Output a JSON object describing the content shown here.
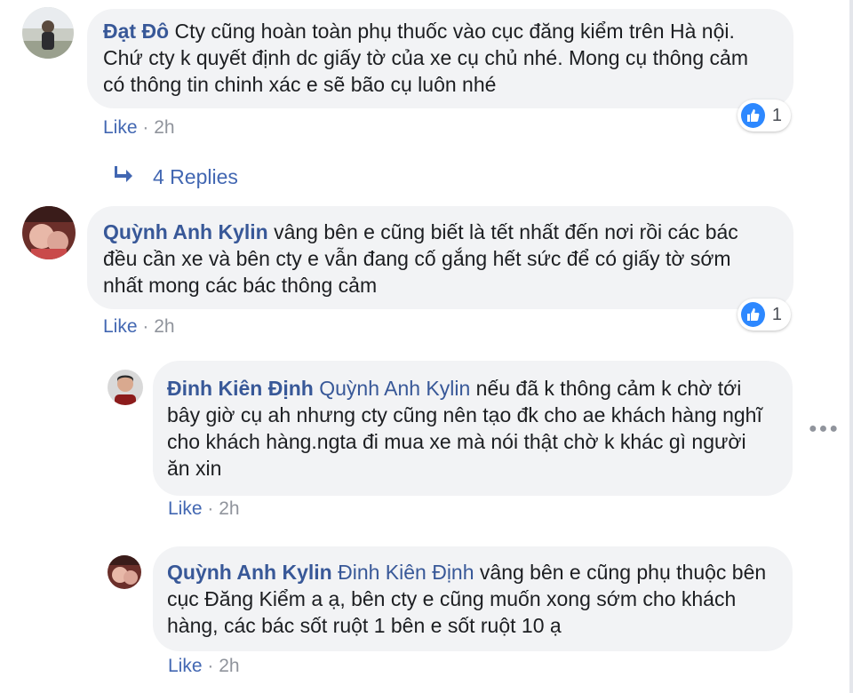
{
  "comments": [
    {
      "author": "Đạt Đô",
      "mention": "",
      "text": "Cty cũng hoàn toàn phụ thuốc vào cục đăng kiểm trên Hà nội. Chứ cty k quyết định dc giấy tờ của xe cụ chủ nhé. Mong cụ thông cảm có thông tin chinh xác e sẽ bão cụ luôn nhé",
      "like_label": "Like",
      "separator": " · ",
      "time": "2h",
      "reaction_count": "1"
    },
    {
      "author": "Quỳnh Anh Kylin",
      "mention": "",
      "text": "vâng bên e cũng biết là tết nhất đến nơi rồi các bác đều cần xe và bên cty e vẫn đang cố gắng hết sức để có giấy tờ sớm nhất mong các bác thông cảm",
      "like_label": "Like",
      "separator": " · ",
      "time": "2h",
      "reaction_count": "1"
    },
    {
      "author": "Đinh Kiên Định",
      "mention": "Quỳnh Anh Kylin",
      "text": "nếu đã k thông cảm k chờ tới bây giờ cụ ah nhưng cty cũng nên tạo đk cho ae khách hàng nghĩ cho khách hàng.ngta đi mua xe mà nói thật chờ k khác gì người ăn xin",
      "like_label": "Like",
      "separator": " · ",
      "time": "2h"
    },
    {
      "author": "Quỳnh Anh Kylin",
      "mention": "Đinh Kiên Định",
      "text": "vâng bên e cũng phụ thuộc bên cục Đăng Kiểm a ạ, bên cty e cũng muốn xong sớm cho khách hàng, các bác sốt ruột 1 bên e sốt ruột 10 ạ",
      "like_label": "Like",
      "separator": " · ",
      "time": "2h"
    }
  ],
  "replies_link": "4 Replies",
  "colors": {
    "author": "#385898",
    "link": "#4267b2",
    "bubble": "#f2f3f5",
    "meta": "#90949c",
    "like_reaction": "#2d88ff"
  },
  "icons": [
    "reply-arrow-icon",
    "like-reaction-icon",
    "more-options-icon"
  ]
}
